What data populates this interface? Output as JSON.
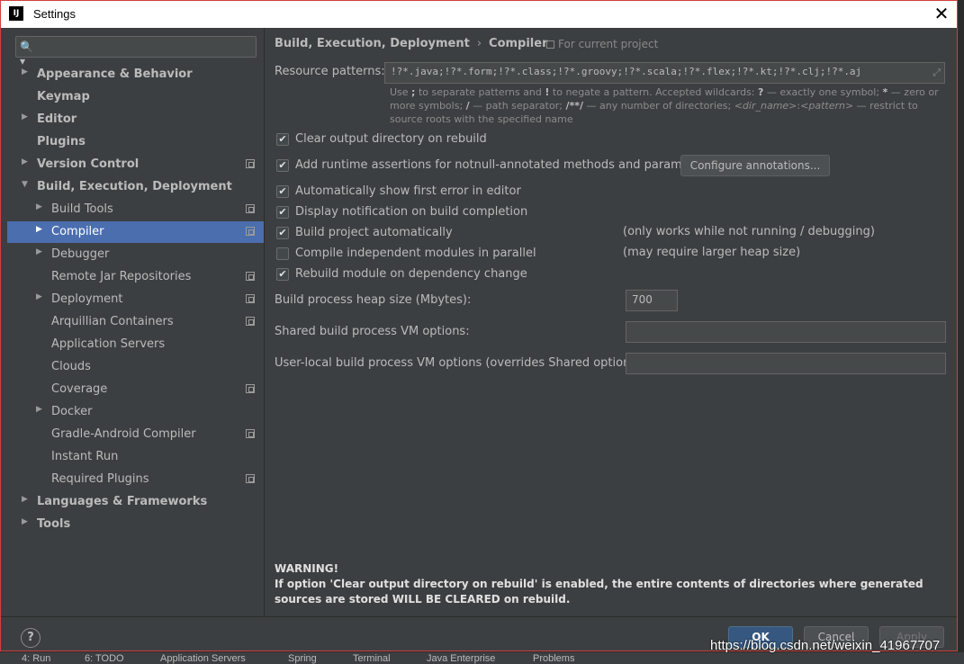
{
  "window": {
    "title": "Settings",
    "app_icon_text": "IJ",
    "close_glyph": "✕"
  },
  "search": {
    "value": "",
    "placeholder": "",
    "icon": "search-icon"
  },
  "sidebar": {
    "items": [
      {
        "label": "Appearance & Behavior",
        "expander": "▶"
      },
      {
        "label": "Keymap"
      },
      {
        "label": "Editor",
        "expander": "▶"
      },
      {
        "label": "Plugins"
      },
      {
        "label": "Version Control",
        "expander": "▶"
      },
      {
        "label": "Build, Execution, Deployment",
        "expander": "▼"
      },
      {
        "label": "Build Tools",
        "expander": "▶"
      },
      {
        "label": "Compiler",
        "expander": "▶",
        "selected": true
      },
      {
        "label": "Debugger",
        "expander": "▶"
      },
      {
        "label": "Remote Jar Repositories"
      },
      {
        "label": "Deployment",
        "expander": "▶"
      },
      {
        "label": "Arquillian Containers"
      },
      {
        "label": "Application Servers"
      },
      {
        "label": "Clouds"
      },
      {
        "label": "Coverage"
      },
      {
        "label": "Docker",
        "expander": "▶"
      },
      {
        "label": "Gradle-Android Compiler"
      },
      {
        "label": "Instant Run"
      },
      {
        "label": "Required Plugins"
      },
      {
        "label": "Languages & Frameworks",
        "expander": "▶"
      },
      {
        "label": "Tools",
        "expander": "▶"
      }
    ]
  },
  "breadcrumb": {
    "parent": "Build, Execution, Deployment",
    "separator": "›",
    "current": "Compiler"
  },
  "scope_note": "For current project",
  "resource_patterns": {
    "label": "Resource patterns:",
    "value": "!?*.java;!?*.form;!?*.class;!?*.groovy;!?*.scala;!?*.flex;!?*.kt;!?*.clj;!?*.aj"
  },
  "hint": {
    "p1": "Use ",
    "k1": ";",
    "p2": " to separate patterns and ",
    "k2": "!",
    "p3": " to negate a pattern. Accepted wildcards: ",
    "k3": "?",
    "p4": " — exactly one symbol; ",
    "k4": "*",
    "p5": " — zero or more symbols; ",
    "k5": "/",
    "p6": " — path separator; ",
    "k6": "/**/",
    "p7": " — any number of directories; ",
    "i1": "<dir_name>",
    "p8": ":",
    "i2": "<pattern>",
    "p9": " — restrict to source roots with the specified name"
  },
  "options": {
    "clear_output": {
      "label": "Clear output directory on rebuild",
      "checked": true
    },
    "runtime_assertions": {
      "label": "Add runtime assertions for notnull-annotated methods and parameters",
      "checked": true
    },
    "configure_annotations": "Configure annotations...",
    "auto_show_error": {
      "label": "Automatically show first error in editor",
      "checked": true
    },
    "display_notification": {
      "label": "Display notification on build completion",
      "checked": true
    },
    "build_automatically": {
      "label": "Build project automatically",
      "checked": true,
      "note": "(only works while not running / debugging)"
    },
    "compile_parallel": {
      "label": "Compile independent modules in parallel",
      "checked": false,
      "note": "(may require larger heap size)"
    },
    "rebuild_on_change": {
      "label": "Rebuild module on dependency change",
      "checked": true
    }
  },
  "heap": {
    "label": "Build process heap size (Mbytes):",
    "value": "700"
  },
  "shared_vm": {
    "label": "Shared build process VM options:",
    "value": ""
  },
  "user_vm": {
    "label": "User-local build process VM options (overrides Shared options):",
    "value": ""
  },
  "warning": {
    "title": "WARNING!",
    "body": "If option 'Clear output directory on rebuild' is enabled, the entire contents of directories where generated sources are stored WILL BE CLEARED on rebuild."
  },
  "footer": {
    "help": "?",
    "ok": "OK",
    "cancel": "Cancel",
    "apply": "Apply"
  },
  "check_glyph": "✔",
  "bottom_strip": [
    "4: Run",
    "6: TODO",
    "Application Servers",
    "Spring",
    "Terminal",
    "Java Enterprise",
    "Problems"
  ],
  "watermark": "https://blog.csdn.net/weixin_41967707"
}
